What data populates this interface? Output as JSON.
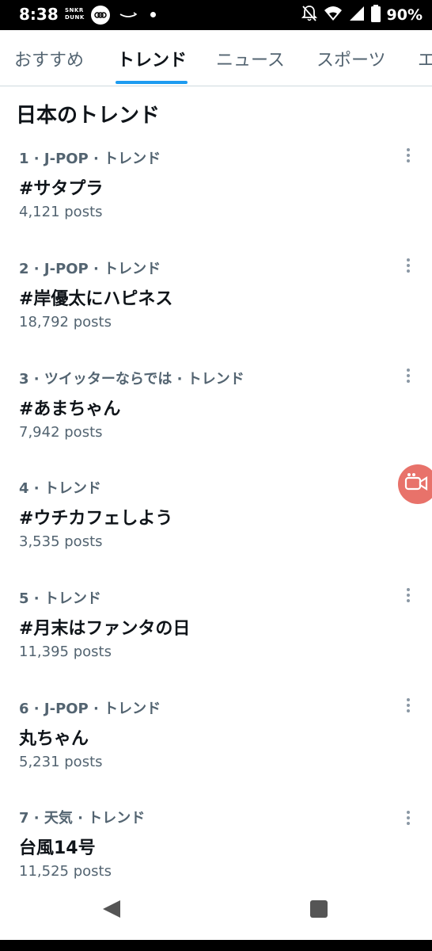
{
  "status_bar": {
    "time": "8:38",
    "app_badge_line1": "SNKR",
    "app_badge_line2": "DUNK",
    "battery": "90%"
  },
  "tabs": [
    {
      "label": "おすすめ"
    },
    {
      "label": "トレンド"
    },
    {
      "label": "ニュース"
    },
    {
      "label": "スポーツ"
    },
    {
      "label": "エ"
    }
  ],
  "section_title": "日本のトレンド",
  "trends": [
    {
      "meta": "1 · J-POP · トレンド",
      "name": "#サタプラ",
      "count": "4,121 posts"
    },
    {
      "meta": "2 · J-POP · トレンド",
      "name": "#岸優太にハピネス",
      "count": "18,792 posts"
    },
    {
      "meta": "3 · ツイッターならでは · トレンド",
      "name": "#あまちゃん",
      "count": "7,942 posts"
    },
    {
      "meta": "4 · トレンド",
      "name": "#ウチカフェしよう",
      "count": "3,535 posts"
    },
    {
      "meta": "5 · トレンド",
      "name": "#月末はファンタの日",
      "count": "11,395 posts"
    },
    {
      "meta": "6 · J-POP · トレンド",
      "name": "丸ちゃん",
      "count": "5,231 posts"
    },
    {
      "meta": "7 · 天気 · トレンド",
      "name": "台風14号",
      "count": "11,525 posts"
    }
  ],
  "colors": {
    "accent": "#1d9bf0",
    "secondary_text": "#536471",
    "fab": "#e8726a"
  },
  "icons": [
    "more-vert-icon",
    "video-call-icon",
    "back-icon",
    "recents-icon",
    "wifi-icon",
    "signal-icon",
    "battery-icon",
    "mute-icon"
  ]
}
